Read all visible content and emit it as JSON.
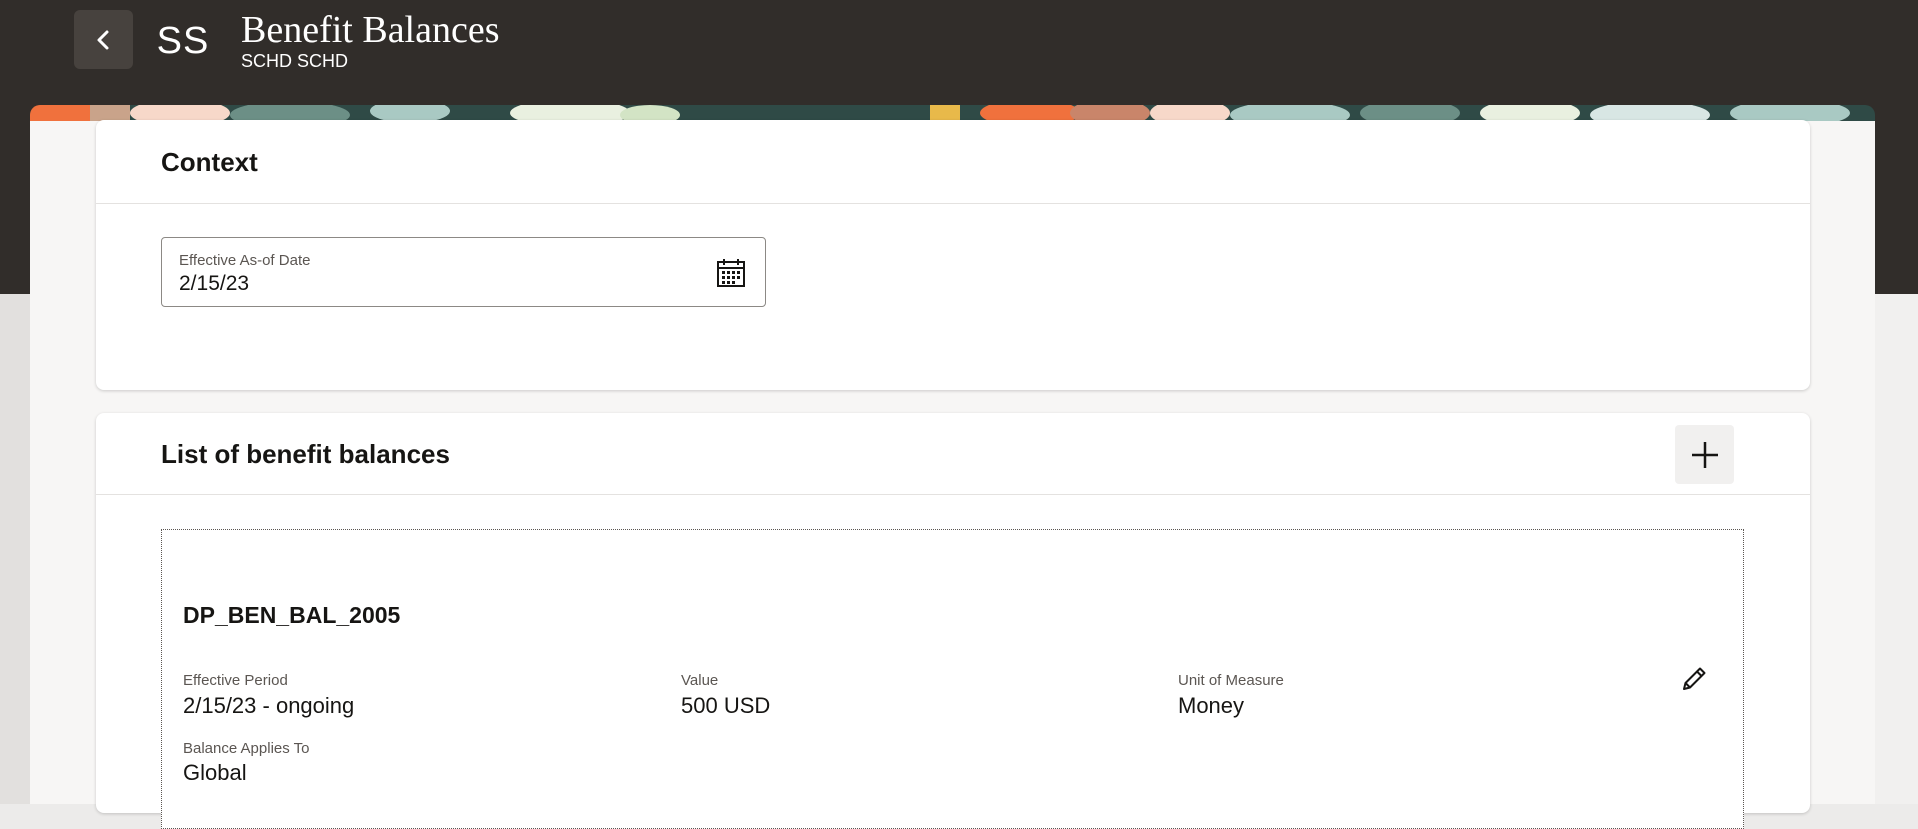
{
  "header": {
    "back_icon": "chevron-left-icon",
    "avatar_initials": "SS",
    "title": "Benefit Balances",
    "subtitle": "SCHD SCHD"
  },
  "context": {
    "title": "Context",
    "date_field": {
      "label": "Effective As-of Date",
      "value": "2/15/23",
      "icon": "calendar-icon"
    }
  },
  "balances": {
    "title": "List of benefit balances",
    "add_icon": "plus-icon",
    "items": [
      {
        "name": "DP_BEN_BAL_2005",
        "effective_period_label": "Effective Period",
        "effective_period": "2/15/23 - ongoing",
        "value_label": "Value",
        "value": "500 USD",
        "uom_label": "Unit of Measure",
        "uom": "Money",
        "applies_to_label": "Balance Applies To",
        "applies_to": "Global",
        "edit_icon": "pencil-icon"
      }
    ]
  },
  "colors": {
    "header_bg": "#312d2a",
    "card_bg": "#ffffff",
    "text_primary": "#161513",
    "text_secondary": "#5b5652"
  }
}
